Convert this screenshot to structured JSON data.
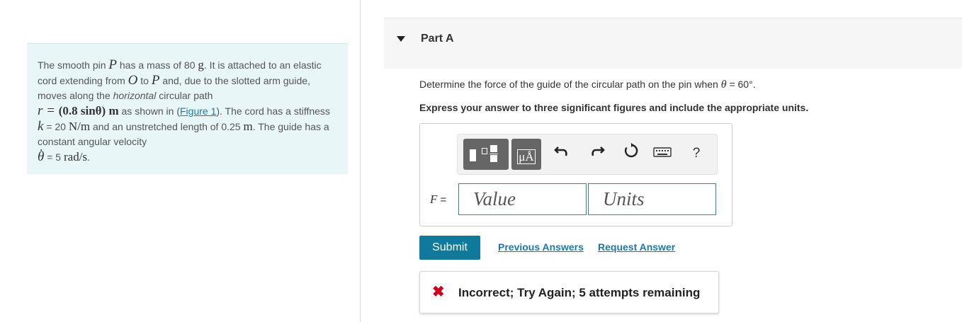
{
  "problem": {
    "t1": "The smooth pin ",
    "P": "P",
    "t2": " has a mass of 80 ",
    "g": "g",
    "t3": ". It is attached to an elastic cord extending from ",
    "O": "O",
    "t4": " to ",
    "P2": "P",
    "t5": " and, due to the slotted arm guide, moves along the ",
    "horizontal": "horizontal",
    "t6": " circular path",
    "r_eq": "r = ",
    "r_expr": "(0.8 sinθ) m",
    "t7": " as shown in (",
    "figure_link": "Figure 1",
    "t8": "). The cord has a stiffness ",
    "k": "k",
    "t9": " = 20 ",
    "k_unit": "N/m",
    "t10": " and an unstretched length of 0.25 ",
    "m": "m",
    "t11": ". The guide has a constant angular velocity",
    "theta_dot": "θ",
    "t12": " = 5 ",
    "omega_unit": "rad/s",
    "t13": "."
  },
  "part": {
    "title": "Part A"
  },
  "question": {
    "text": "Determine the force of the guide of the circular path on the pin when ",
    "theta": "θ",
    "tail": " = 60°."
  },
  "instruction": "Express your answer to three significant figures and include the appropriate units.",
  "toolbar": {
    "units_label": "μÅ",
    "undo_icon": "undo-icon",
    "redo_icon": "redo-icon",
    "reset_icon": "reset-icon",
    "keyboard_icon": "keyboard-icon",
    "help_label": "?"
  },
  "answer": {
    "var": "F",
    "eq": " =",
    "value_placeholder": "Value",
    "units_placeholder": "Units"
  },
  "actions": {
    "submit": "Submit",
    "previous_answers": "Previous Answers",
    "request_answer": "Request Answer"
  },
  "feedback": {
    "icon": "✖",
    "message": "Incorrect; Try Again; 5 attempts remaining"
  },
  "colors": {
    "accent": "#0f7a9c",
    "link": "#1a7ab0",
    "error": "#d0021b",
    "problem_bg": "#e8f6f8"
  }
}
